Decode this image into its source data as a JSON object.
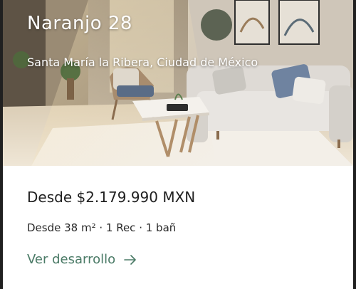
{
  "listing": {
    "title": "Naranjo 28",
    "location": "Santa María la Ribera, Ciudad de México",
    "price": "Desde $2.179.990 MXN",
    "specs": "Desde 38 m² · 1 Rec · 1 bañ",
    "cta_label": "Ver desarrollo",
    "cta_icon": "arrow-right-icon"
  },
  "colors": {
    "accent": "#4a7a66",
    "text": "#1f1f1f",
    "border": "#202020"
  }
}
